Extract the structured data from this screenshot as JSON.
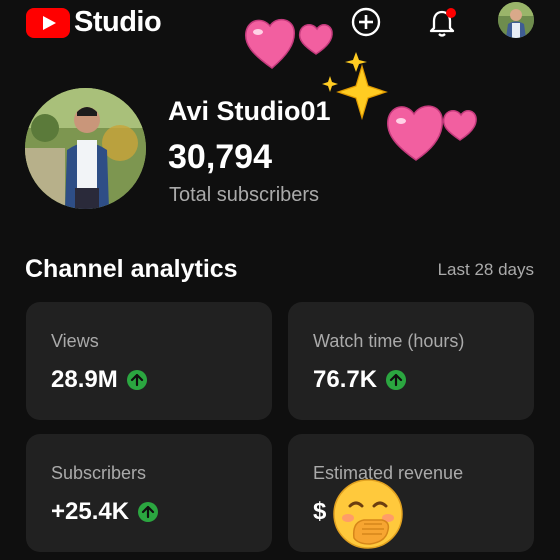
{
  "app": {
    "logo_text": "Studio",
    "brand_color": "#ff0000"
  },
  "header": {
    "create_icon": "plus-circle-icon",
    "notifications_icon": "bell-icon",
    "notification_badge_color": "#ff0000"
  },
  "channel": {
    "name": "Avi Studio01",
    "subscriber_count": "30,794",
    "subscriber_label": "Total subscribers"
  },
  "analytics": {
    "title": "Channel analytics",
    "period": "Last 28 days",
    "cards": [
      {
        "label": "Views",
        "value": "28.9M",
        "trend": "up"
      },
      {
        "label": "Watch time (hours)",
        "value": "76.7K",
        "trend": "up"
      },
      {
        "label": "Subscribers",
        "value": "+25.4K",
        "trend": "up"
      },
      {
        "label": "Estimated revenue",
        "value": "$",
        "trend": "hidden"
      }
    ]
  },
  "colors": {
    "trend_up": "#2ba640",
    "background": "#0f0f0f",
    "card": "#212121"
  }
}
